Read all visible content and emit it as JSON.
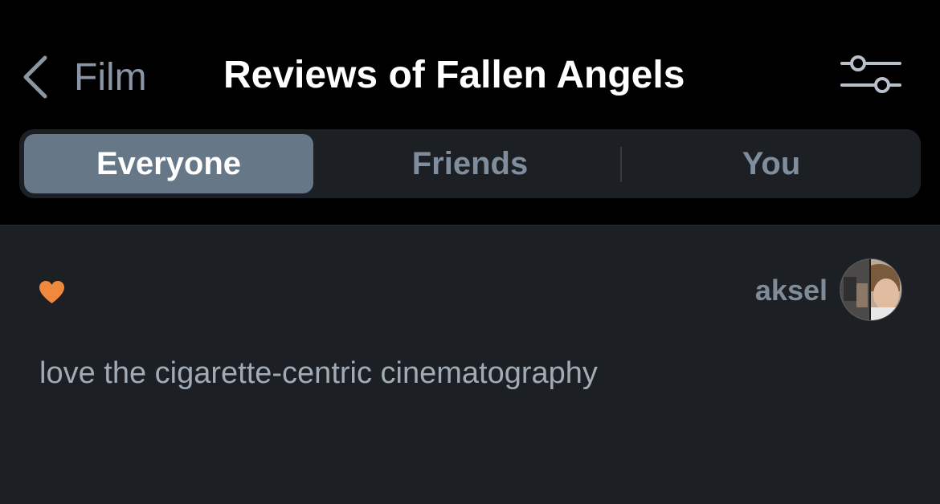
{
  "nav": {
    "back_label": "Film",
    "title": "Reviews of Fallen Angels",
    "back_icon": "chevron-left-icon",
    "filter_icon": "sliders-icon"
  },
  "tabs": [
    {
      "label": "Everyone",
      "active": true
    },
    {
      "label": "Friends",
      "active": false
    },
    {
      "label": "You",
      "active": false
    }
  ],
  "review": {
    "liked": true,
    "heart_icon": "heart-icon",
    "heart_color": "#f0883e",
    "username": "aksel",
    "text": "love the cigarette-centric cinematography"
  },
  "colors": {
    "accent_tab": "#667788",
    "background": "#000000",
    "content_background": "#1c1f23"
  }
}
